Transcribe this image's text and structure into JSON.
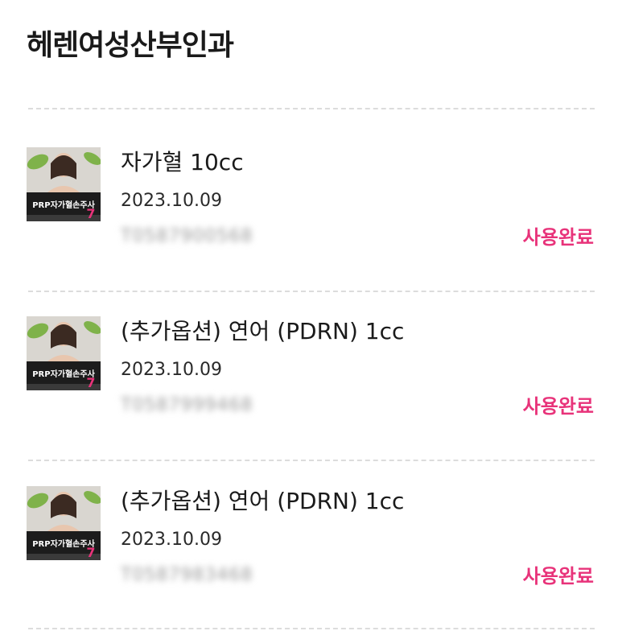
{
  "clinic": {
    "title": "헤렌여성산부인과"
  },
  "colors": {
    "status": "#e8337a",
    "divider": "#dcdcdc",
    "thumb_banner": "#1c1c1c",
    "thumb_leaf": "#7fb24a",
    "thumb_accent": "#e8337a"
  },
  "items": [
    {
      "name": "자가혈 10cc",
      "date": "2023.10.09",
      "code": "T0587900568",
      "status": "사용완료",
      "thumb": {
        "banner_text": "PRP자가혈손주사",
        "badge": "7"
      }
    },
    {
      "name": "(추가옵션) 연어 (PDRN) 1cc",
      "date": "2023.10.09",
      "code": "T0587999468",
      "status": "사용완료",
      "thumb": {
        "banner_text": "PRP자가혈손주사",
        "badge": "7"
      }
    },
    {
      "name": "(추가옵션) 연어 (PDRN) 1cc",
      "date": "2023.10.09",
      "code": "T0587983468",
      "status": "사용완료",
      "thumb": {
        "banner_text": "PRP자가혈손주사",
        "badge": "7"
      }
    }
  ]
}
